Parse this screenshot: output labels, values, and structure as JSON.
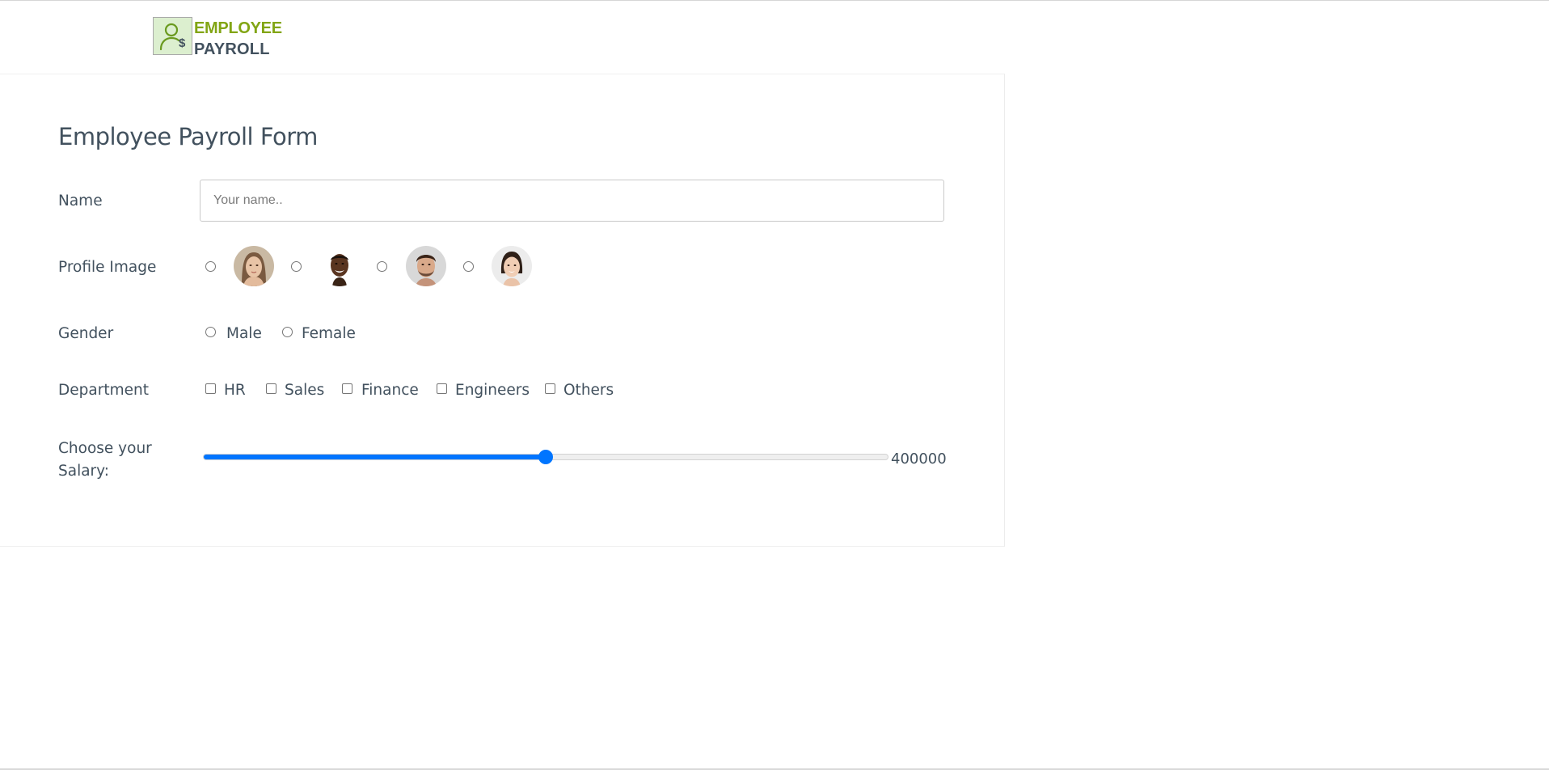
{
  "logo": {
    "line1": "EMPLOYEE",
    "line2": "PAYROLL"
  },
  "form": {
    "title": "Employee Payroll Form",
    "name": {
      "label": "Name",
      "placeholder": "Your name..",
      "value": ""
    },
    "profile_image": {
      "label": "Profile Image",
      "options": [
        "avatar-woman-1",
        "avatar-man-1",
        "avatar-man-2",
        "avatar-woman-2"
      ]
    },
    "gender": {
      "label": "Gender",
      "options": [
        "Male",
        "Female"
      ]
    },
    "department": {
      "label": "Department",
      "options": [
        "HR",
        "Sales",
        "Finance",
        "Engineers",
        "Others"
      ]
    },
    "salary": {
      "label_line1": "Choose your",
      "label_line2": "Salary:",
      "value": "400000",
      "fraction": 0.5
    }
  },
  "colors": {
    "accent": "#0075ff",
    "logo_green": "#82a514",
    "text_dark": "#42515e"
  }
}
